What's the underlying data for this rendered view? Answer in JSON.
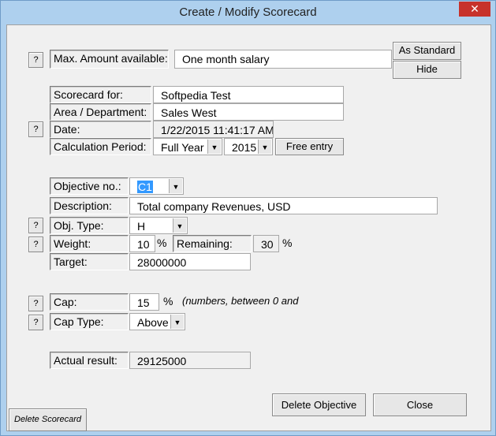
{
  "window": {
    "title": "Create / Modify Scorecard",
    "close_glyph": "✕"
  },
  "help_glyph": "?",
  "max_amount": {
    "label": "Max. Amount available:",
    "value": "One month salary"
  },
  "buttons": {
    "as_standard": "As Standard",
    "hide": "Hide",
    "free_entry": "Free entry",
    "delete_objective": "Delete Objective",
    "close": "Close",
    "delete_scorecard": "Delete Scorecard"
  },
  "scorecard": {
    "for_label": "Scorecard for:",
    "for_value": "Softpedia Test",
    "area_label": "Area / Department:",
    "area_value": "Sales West",
    "date_label": "Date:",
    "date_value": "1/22/2015 11:41:17 AM",
    "period_label": "Calculation Period:",
    "period_value": "Full Year",
    "year_value": "2015"
  },
  "objective": {
    "no_label": "Objective no.:",
    "no_value": "C1",
    "desc_label": "Description:",
    "desc_value": "Total company Revenues, USD",
    "type_label": "Obj. Type:",
    "type_value": "H",
    "weight_label": "Weight:",
    "weight_value": "10",
    "weight_unit": "%",
    "remaining_label": "Remaining:",
    "remaining_value": "30",
    "remaining_unit": "%",
    "target_label": "Target:",
    "target_value": "28000000"
  },
  "cap": {
    "label": "Cap:",
    "value": "15",
    "unit": "%",
    "hint": "(numbers, between 0 and",
    "type_label": "Cap Type:",
    "type_value": "Above"
  },
  "actual": {
    "label": "Actual result:",
    "value": "29125000"
  },
  "dropdown_glyph": "▼",
  "colors": {
    "title_bg": "#aed0ee",
    "close_red": "#c7322b",
    "selection": "#3399ff"
  }
}
